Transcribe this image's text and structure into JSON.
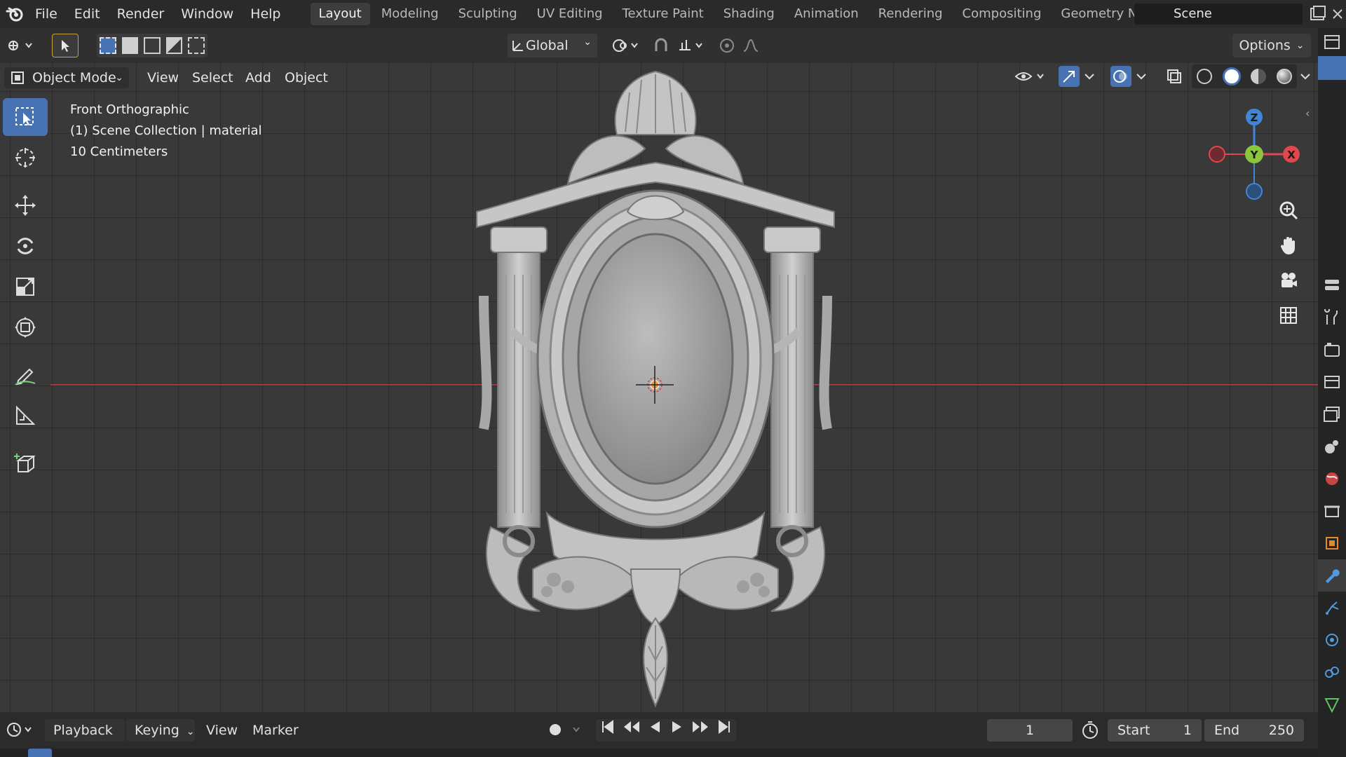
{
  "menu": {
    "items": [
      "File",
      "Edit",
      "Render",
      "Window",
      "Help"
    ]
  },
  "workspaces": {
    "tabs": [
      "Layout",
      "Modeling",
      "Sculpting",
      "UV Editing",
      "Texture Paint",
      "Shading",
      "Animation",
      "Rendering",
      "Compositing",
      "Geometry Nod"
    ],
    "active_index": 0
  },
  "scene": {
    "name": "Scene"
  },
  "toolheader": {
    "transform_orientation": "Global",
    "options_label": "Options"
  },
  "viewport_header": {
    "mode": "Object Mode",
    "menus": [
      "View",
      "Select",
      "Add",
      "Object"
    ]
  },
  "overlay": {
    "view_name": "Front Orthographic",
    "collection": "(1) Scene Collection | material",
    "scale": "10 Centimeters"
  },
  "gizmo": {
    "z_label": "Z",
    "y_label": "Y",
    "x_label": "X"
  },
  "timeline": {
    "menus": [
      "Playback",
      "Keying",
      "View",
      "Marker"
    ],
    "current_frame": "1",
    "start_label": "Start",
    "start_value": "1",
    "end_label": "End",
    "end_value": "250"
  },
  "colors": {
    "accent": "#4772b3",
    "x_axis": "#e0474f",
    "y_axis": "#8cc63f",
    "z_axis": "#3f87d6"
  }
}
